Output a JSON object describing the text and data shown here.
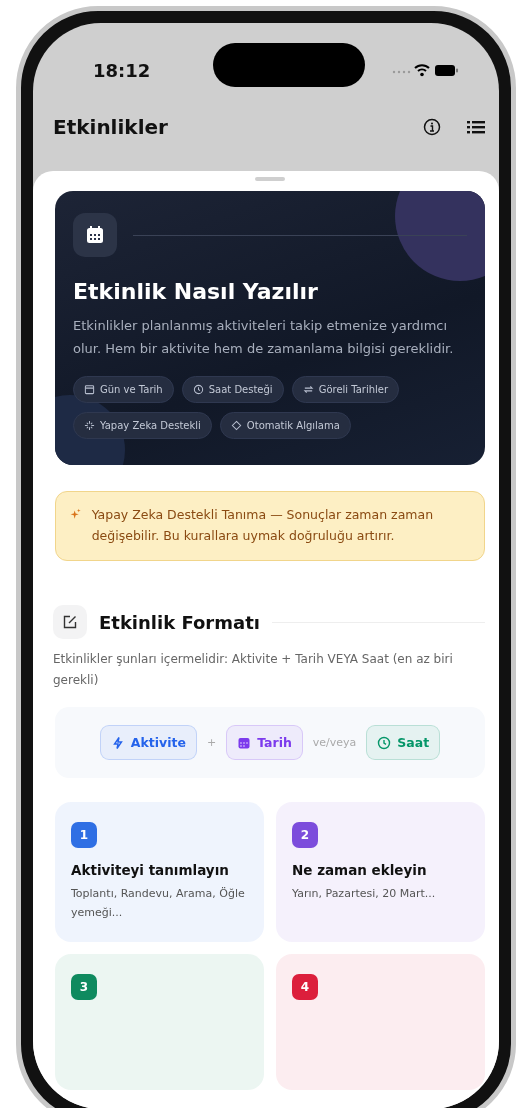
{
  "status_bar": {
    "time": "18:12"
  },
  "nav": {
    "title": "Etkinlikler"
  },
  "hero": {
    "title": "Etkinlik Nasıl Yazılır",
    "description": "Etkinlikler planlanmış aktiviteleri takip etmenize yardımcı olur. Hem bir aktivite hem de zamanlama bilgisi gereklidir.",
    "chips": [
      {
        "kind": "calendar",
        "label": "Gün ve Tarih"
      },
      {
        "kind": "clock",
        "label": "Saat Desteği"
      },
      {
        "kind": "swap",
        "label": "Göreli Tarihler"
      },
      {
        "kind": "sparkle",
        "label": "Yapay Zeka Destekli"
      },
      {
        "kind": "target",
        "label": "Otomatik Algılama"
      }
    ]
  },
  "notice": {
    "text": "Yapay Zeka Destekli Tanıma — Sonuçlar zaman zaman değişebilir. Bu kurallara uymak doğruluğu artırır."
  },
  "format_section": {
    "title": "Etkinlik Formatı",
    "description": "Etkinlikler şunları içermelidir: Aktivite + Tarih VEYA Saat (en az biri gerekli)",
    "tokens": [
      {
        "kind": "token",
        "label": "Aktivite",
        "color": "#2563eb"
      },
      {
        "kind": "operator",
        "label": "+"
      },
      {
        "kind": "token",
        "label": "Tarih",
        "color": "#7c3aed"
      },
      {
        "kind": "operator",
        "label": "ve/veya"
      },
      {
        "kind": "token",
        "label": "Saat",
        "color": "#059669"
      }
    ]
  },
  "steps": [
    {
      "number": "1",
      "title": "Aktiviteyi tanımlayın",
      "description": "Toplantı, Randevu, Arama, Öğle yemeği...",
      "color": "#2f6fe4"
    },
    {
      "number": "2",
      "title": "Ne zaman ekleyin",
      "description": "Yarın, Pazartesi, 20 Mart...",
      "color": "#7c4ddc"
    },
    {
      "number": "3",
      "color": "#0f8a5f"
    },
    {
      "number": "4",
      "color": "#dc1f3c"
    }
  ]
}
